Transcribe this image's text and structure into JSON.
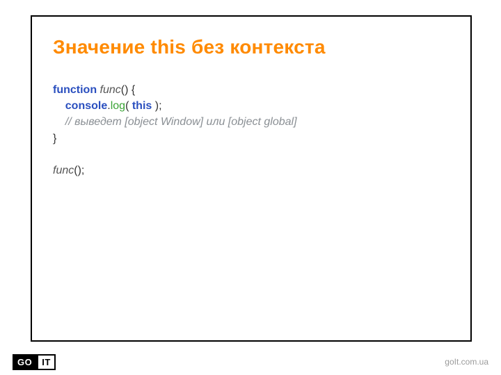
{
  "slide": {
    "title": "Значение this без контекста",
    "code": {
      "l1": {
        "kw": "function",
        "fn": " func",
        "tail": "() {"
      },
      "l2": {
        "indent": "    ",
        "obj": "console",
        "dot": ".",
        "meth": "log",
        "open": "( ",
        "this": "this",
        "close": " );"
      },
      "l3": {
        "indent": "    ",
        "comment": "// выведет [object Window] или [object global]"
      },
      "l4": "}",
      "blank": "",
      "l5": {
        "fn": "func",
        "tail": "();"
      }
    }
  },
  "footer": {
    "logo_go": "GO",
    "logo_it": "IT",
    "url": "goIt.com.ua"
  }
}
